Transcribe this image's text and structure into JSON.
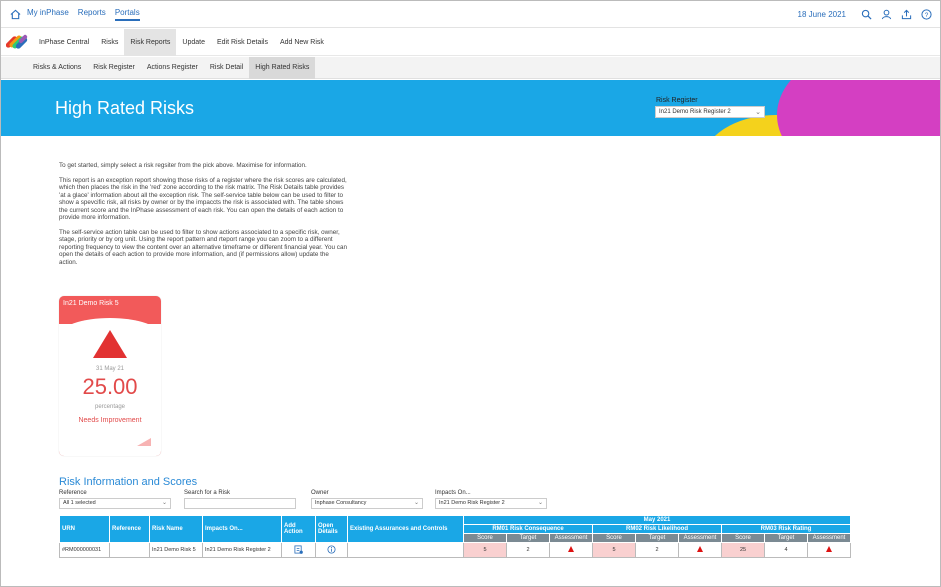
{
  "topbar": {
    "nav": [
      {
        "label": "My inPhase",
        "active": false
      },
      {
        "label": "Reports",
        "active": false
      },
      {
        "label": "Portals",
        "active": true
      }
    ],
    "date": "18 June 2021",
    "icons": [
      "search-icon",
      "user-icon",
      "upload-icon",
      "help-icon"
    ]
  },
  "nav2": {
    "items": [
      {
        "label": "InPhase Central",
        "active": false
      },
      {
        "label": "Risks",
        "active": false
      },
      {
        "label": "Risk Reports",
        "active": true
      },
      {
        "label": "Update",
        "active": false
      },
      {
        "label": "Edit Risk Details",
        "active": false
      },
      {
        "label": "Add New Risk",
        "active": false
      }
    ]
  },
  "nav3": {
    "items": [
      {
        "label": "Risks & Actions",
        "active": false
      },
      {
        "label": "Risk Register",
        "active": false
      },
      {
        "label": "Actions Register",
        "active": false
      },
      {
        "label": "Risk Detail",
        "active": false
      },
      {
        "label": "High Rated Risks",
        "active": true
      }
    ]
  },
  "banner": {
    "title": "High Rated Risks",
    "register_label": "Risk Register",
    "register_value": "In21 Demo Risk Register 2",
    "colors": {
      "blue": "#1aa7e6",
      "pink": "#d43fc2",
      "yellow": "#f4d21c"
    }
  },
  "intro": {
    "paragraphs": [
      "To get started, simply select a risk regsiter from the pick above. Maximise for information.",
      "This report is an exception report showing those risks of a register where the risk scores are calculated, which then places the risk in the 'red' zone according to the risk matrix. The Risk Details table provides 'at a glace' information about all the exception risk. The self-service table below can be used to filter to show a spevcific risk, all risks by owner or by the impaccts the risk is associated with. The table shows the current score and the InPhase assessment of each risk. You can open the details of each action to provide more information.",
      "The self-service action table can be used to filter to show actions associated to a specific risk, owner, stage, priority or by org unit. Using the report pattern and rteport range you can zoom to a different reporting frequency to view the content over an alternative timeframe or different financial year. You can open the details of each action to provide more information, and (if permissions allow) update the action."
    ]
  },
  "kpi": {
    "title": "In21 Demo Risk 5",
    "date": "31 May 21",
    "value": "25.00",
    "unit": "percentage",
    "status": "Needs Improvement",
    "color": "#e24a4a"
  },
  "section": {
    "title": "Risk Information and Scores",
    "filters": [
      {
        "label": "Reference",
        "value": "All 1 selected"
      },
      {
        "label": "Search for a Risk",
        "value": ""
      },
      {
        "label": "Owner",
        "value": "Inphase Consultancy"
      },
      {
        "label": "Impacts On...",
        "value": "In21 Demo Risk Register 2"
      }
    ]
  },
  "table": {
    "headers": [
      "URN",
      "Reference",
      "Risk Name",
      "Impacts On...",
      "Add Action",
      "Open Details",
      "Existing Assurances and Controls"
    ],
    "period": "May 2021",
    "groups": [
      "RM01 Risk Consequence",
      "RM02 Risk Likelihood",
      "RM03 Risk Rating"
    ],
    "subheaders": [
      "Score",
      "Target",
      "Assessment"
    ],
    "rows": [
      {
        "urn": "#RM000000031",
        "reference": "",
        "risk_name": "In21 Demo Risk 5",
        "impacts_on": "In21 Demo Risk Register 2",
        "assurances": "",
        "rm01_score": "5",
        "rm01_target": "2",
        "rm02_score": "5",
        "rm02_target": "2",
        "rm03_score": "25",
        "rm03_target": "4"
      }
    ]
  }
}
